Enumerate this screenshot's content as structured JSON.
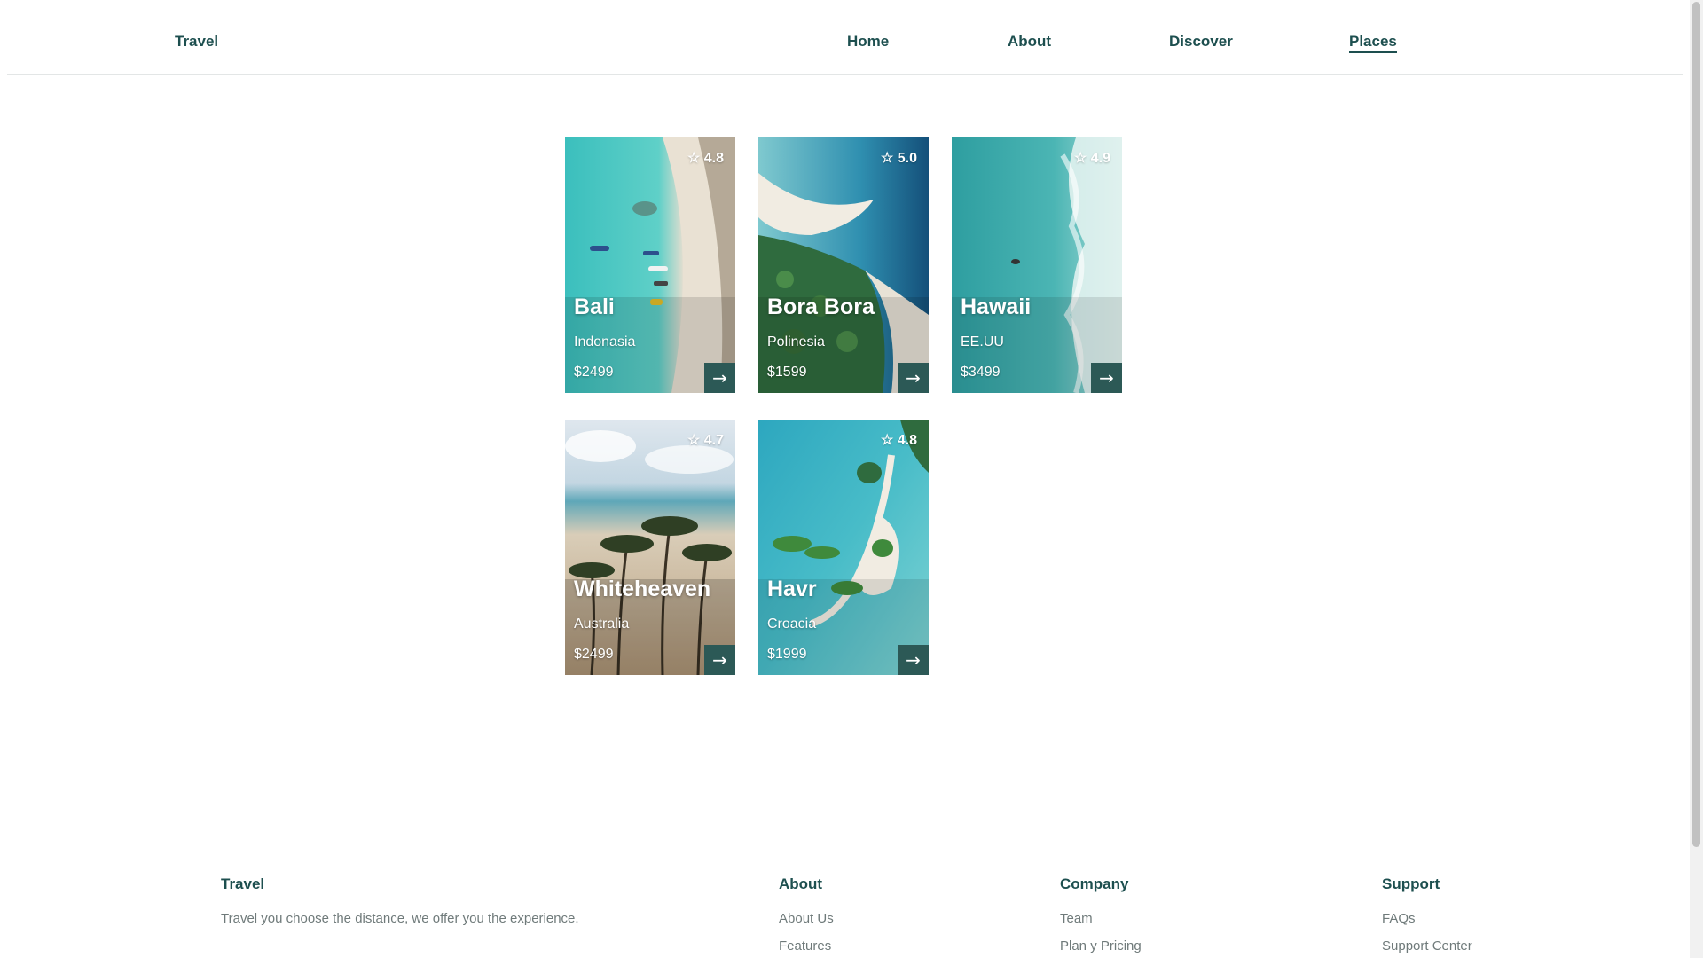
{
  "header": {
    "logo": "Travel",
    "nav": [
      {
        "label": "Home"
      },
      {
        "label": "About"
      },
      {
        "label": "Discover"
      },
      {
        "label": "Places",
        "active": true
      }
    ]
  },
  "places": [
    {
      "title": "Bali",
      "country": "Indonasia",
      "price": "$2499",
      "rating": "☆ 4.8"
    },
    {
      "title": "Bora Bora",
      "country": "Polinesia",
      "price": "$1599",
      "rating": "☆ 5.0"
    },
    {
      "title": "Hawaii",
      "country": "EE.UU",
      "price": "$3499",
      "rating": "☆ 4.9"
    },
    {
      "title": "Whiteheaven",
      "country": "Australia",
      "price": "$2499",
      "rating": "☆ 4.7"
    },
    {
      "title": "Havr",
      "country": "Croacia",
      "price": "$1999",
      "rating": "☆ 4.8"
    }
  ],
  "card_arrow": "→",
  "icons": {
    "rating": "star-outline-icon",
    "card_action": "arrow-right-icon"
  },
  "colors": {
    "brand": "#1d4f4f",
    "button": "#2c5956",
    "muted_text": "#6f7a7a"
  },
  "footer": {
    "brand": {
      "title": "Travel",
      "description": "Travel you choose the distance, we offer you the experience."
    },
    "columns": [
      {
        "title": "About",
        "links": [
          "About Us",
          "Features"
        ]
      },
      {
        "title": "Company",
        "links": [
          "Team",
          "Plan y Pricing"
        ]
      },
      {
        "title": "Support",
        "links": [
          "FAQs",
          "Support Center"
        ]
      }
    ]
  }
}
